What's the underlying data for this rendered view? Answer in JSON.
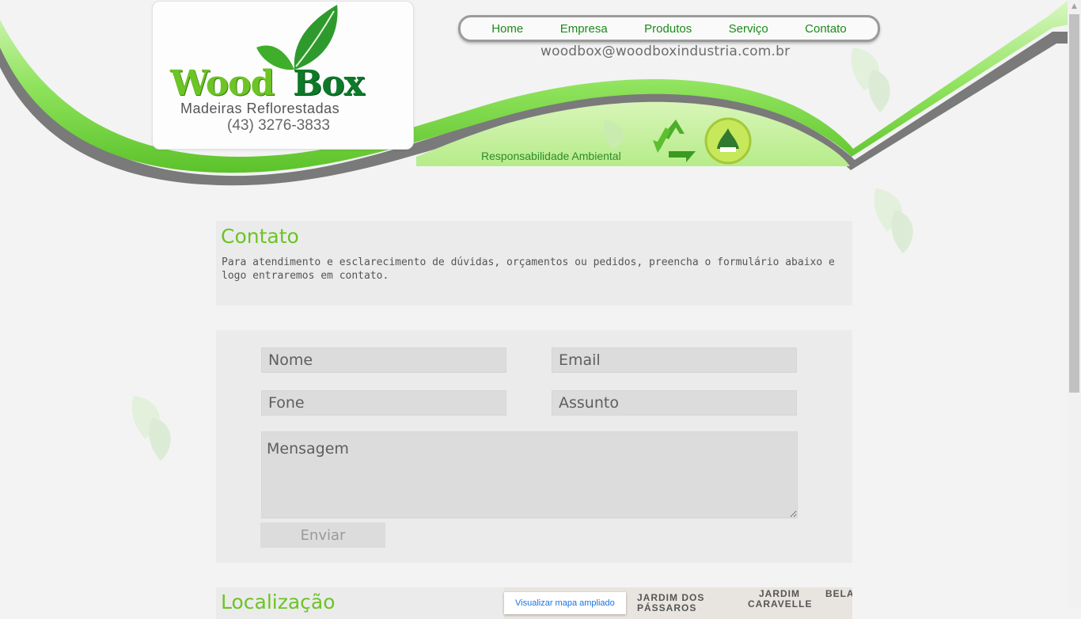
{
  "brand": {
    "word1": "Wood",
    "word2": "Box",
    "subtitle": "Madeiras Reflorestadas",
    "phone": "(43) 3276-3833",
    "accent_green": "#6cc425",
    "dark_green": "#0d7a2a"
  },
  "nav": {
    "items": [
      {
        "label": "Home"
      },
      {
        "label": "Empresa"
      },
      {
        "label": "Produtos"
      },
      {
        "label": "Serviço"
      },
      {
        "label": "Contato"
      }
    ]
  },
  "header": {
    "email": "woodbox@woodboxindustria.com.br",
    "responsibility": "Responsabilidade Ambiental"
  },
  "contact": {
    "title": "Contato",
    "description": "Para atendimento e esclarecimento de dúvidas, orçamentos ou pedidos, preencha o formulário abaixo e logo entraremos em contato."
  },
  "form": {
    "name_placeholder": "Nome",
    "email_placeholder": "Email",
    "phone_placeholder": "Fone",
    "subject_placeholder": "Assunto",
    "message_placeholder": "Mensagem",
    "submit_label": "Enviar"
  },
  "location": {
    "title": "Localização",
    "map_button": "Visualizar mapa ampliado",
    "map_labels": [
      "JARDIM DOS",
      "PÁSSAROS",
      "JARDIM",
      "CARAVELLE",
      "BELA"
    ]
  }
}
